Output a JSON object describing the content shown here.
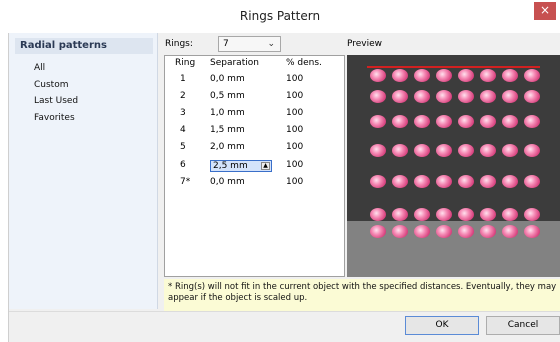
{
  "window": {
    "title": "Rings Pattern",
    "close_glyph": "×"
  },
  "sidebar": {
    "heading": "Radial patterns",
    "items": [
      {
        "label": "All"
      },
      {
        "label": "Custom"
      },
      {
        "label": "Last Used"
      },
      {
        "label": "Favorites"
      }
    ]
  },
  "rings": {
    "label": "Rings:",
    "value": "7"
  },
  "table": {
    "headers": [
      "Ring",
      "Separation",
      "% dens."
    ],
    "rows": [
      {
        "ring": "1",
        "separation": "0,0 mm",
        "density": "100"
      },
      {
        "ring": "2",
        "separation": "0,5 mm",
        "density": "100"
      },
      {
        "ring": "3",
        "separation": "1,0 mm",
        "density": "100"
      },
      {
        "ring": "4",
        "separation": "1,5 mm",
        "density": "100"
      },
      {
        "ring": "5",
        "separation": "2,0 mm",
        "density": "100"
      },
      {
        "ring": "6",
        "separation": "2,5 mm",
        "density": "100"
      },
      {
        "ring": "7*",
        "separation": "0,0 mm",
        "density": "100"
      }
    ],
    "editing_row": 5
  },
  "preview": {
    "label": "Preview",
    "background_color": "#3c3c3c",
    "ground_color": "#828282",
    "line_color": "#d22020",
    "gem_color": "#e8609a",
    "rows": 7,
    "gems_per_row": 8
  },
  "note": "* Ring(s) will not fit in the current object with the specified distances. Eventually, they may appear if the object is scaled up.",
  "buttons": {
    "ok": "OK",
    "cancel": "Cancel"
  }
}
